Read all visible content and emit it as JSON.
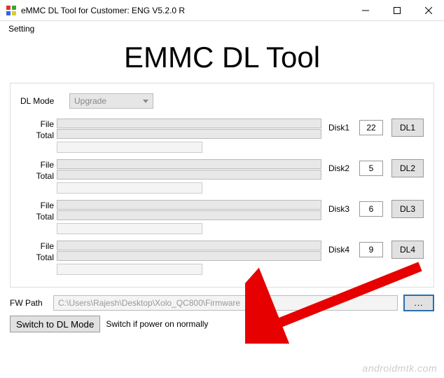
{
  "window": {
    "title": "eMMC DL Tool for Customer: ENG V5.2.0 R"
  },
  "menu": {
    "setting": "Setting"
  },
  "heading": "EMMC DL Tool",
  "dlmode": {
    "label": "DL Mode",
    "value": "Upgrade"
  },
  "diskLabels": {
    "file": "File",
    "total": "Total"
  },
  "disks": [
    {
      "label": "Disk1",
      "num": "22",
      "btn": "DL1"
    },
    {
      "label": "Disk2",
      "num": "5",
      "btn": "DL2"
    },
    {
      "label": "Disk3",
      "num": "6",
      "btn": "DL3"
    },
    {
      "label": "Disk4",
      "num": "9",
      "btn": "DL4"
    }
  ],
  "fwpath": {
    "label": "FW Path",
    "value": "C:\\Users\\Rajesh\\Desktop\\Xolo_QC800\\Firmware",
    "browse": "..."
  },
  "bottom": {
    "switchBtn": "Switch to DL Mode",
    "switchHint": "Switch if power on normally"
  },
  "watermark": "androidmtk.com"
}
